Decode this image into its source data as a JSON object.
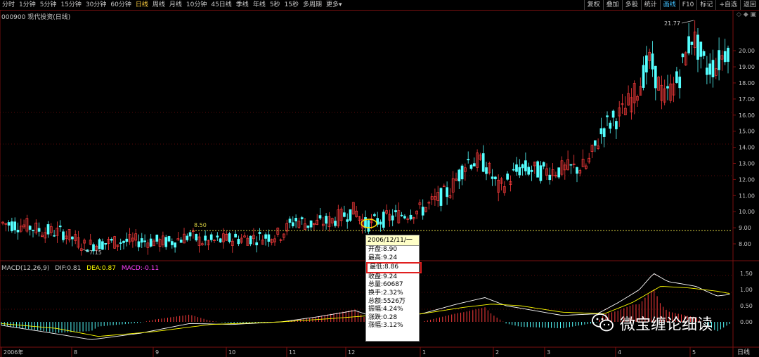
{
  "toolbar": {
    "periods": [
      "分时",
      "1分钟",
      "5分钟",
      "15分钟",
      "30分钟",
      "60分钟",
      "日线",
      "周线",
      "月线",
      "10分钟",
      "45日线",
      "季线",
      "年线",
      "5秒",
      "15秒",
      "多周期",
      "更多▾"
    ],
    "active_period": "日线",
    "right": [
      "复权",
      "叠加",
      "多股",
      "统计",
      "画线",
      "F10",
      "标记",
      "+自选",
      "返回"
    ],
    "right_active": "画线"
  },
  "stock": {
    "title": "000900 现代投资(日线)"
  },
  "price_axis": {
    "labels": [
      "20.00",
      "19.00",
      "18.00",
      "17.00",
      "16.00",
      "15.00",
      "14.00",
      "13.00",
      "12.00",
      "11.00",
      "10.00",
      "9.00",
      "8.00"
    ],
    "min": 7.0,
    "max": 21.0
  },
  "annotations": {
    "high": "21.77",
    "low": "7.15",
    "dashed_level": "8.50"
  },
  "macd": {
    "title": "MACD(12,26,9)",
    "dif_label": "DIF:",
    "dif": "0.81",
    "dea_label": "DEA:",
    "dea": "0.87",
    "macd_label": "MACD:",
    "macd_val": "-0.11",
    "axis_labels": [
      "1.50",
      "1.00",
      "0.50",
      "0.00"
    ]
  },
  "time_axis": {
    "labels": [
      "2006年",
      "8",
      "9",
      "10",
      "11",
      "12",
      "1",
      "2",
      "3",
      "4",
      "5"
    ],
    "period_label": "日线"
  },
  "tooltip": {
    "date": "2006/12/11/一",
    "open": "开盘:8.90",
    "high": "最高:9.24",
    "low": "最低:8.86",
    "close": "收盘:9.24",
    "volume": "总量:60687",
    "turnover": "换手:2.32%",
    "amount": "总额:5526万",
    "amplitude": "振幅:4.24%",
    "change": "涨跌:0.28",
    "change_pct": "涨幅:3.12%"
  },
  "watermark": {
    "text": "微宝缠论细读"
  },
  "colors": {
    "up": "#ff3c3c",
    "down": "#54ffff",
    "dif": "#ffffff",
    "dea": "#ffff00",
    "macd": "#ff40ff",
    "grid": "#7a1010"
  }
}
